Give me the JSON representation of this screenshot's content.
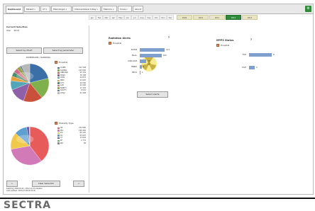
{
  "tabs": [
    {
      "label": "Dashboard"
    },
    {
      "label": "Patient"
    },
    {
      "label": "CT"
    },
    {
      "label": "Plain/Angio"
    },
    {
      "label": "Interventional X-Ray"
    },
    {
      "label": "Mammo"
    },
    {
      "label": "Cross"
    },
    {
      "label": "About"
    }
  ],
  "months": [
    "Jan",
    "Feb",
    "Mar",
    "Apr",
    "May",
    "Jun",
    "Jul",
    "Aug",
    "Sep",
    "Oct",
    "Nov",
    "Dec"
  ],
  "years": [
    {
      "label": "2009",
      "selected": false
    },
    {
      "label": "2010",
      "selected": false
    },
    {
      "label": "2011",
      "selected": false
    },
    {
      "label": "2012",
      "selected": true
    },
    {
      "label": "2013",
      "selected": false
    }
  ],
  "left": {
    "current_selection": "Current Selection",
    "year_label": "Year",
    "year_value": "2012",
    "select_chart_btn": "Select by Chart",
    "select_param_btn": "Select by parameter",
    "dimension_title": "DIMENSION / RANKING",
    "hospital_label": "Hospital",
    "hospital_rows": [
      {
        "label": "CLINIC",
        "value": "121 548",
        "color": "#3b6fa8"
      },
      {
        "label": "GLOBAL",
        "value": "103 000",
        "color": "#7fb04b"
      },
      {
        "label": "UNILUND",
        "value": "93 154",
        "color": "#c9503a"
      },
      {
        "label": "HOSP",
        "value": "78 108",
        "color": "#8f5fa8"
      },
      {
        "label": "ICON",
        "value": "44 872",
        "color": "#52a6b8"
      },
      {
        "label": "MED",
        "value": "23 087",
        "color": "#e8a03c"
      },
      {
        "label": "CITY",
        "value": "22 000",
        "color": "#4a8f6d"
      },
      {
        "label": "LAB",
        "value": "21 000",
        "color": "#d06b8a"
      },
      {
        "label": "NORTH",
        "value": "17 432",
        "color": "#9aa14a"
      },
      {
        "label": "SOUTH",
        "value": "8 001",
        "color": "#5d7f9f"
      },
      {
        "label": "Other",
        "value": "41 948",
        "color": "#b8b8b8"
      }
    ],
    "modality_label": "Modality Type",
    "modality_rows": [
      {
        "label": "CR",
        "value": "232 660",
        "color": "#e85b5b"
      },
      {
        "label": "MG",
        "value": "190 462",
        "color": "#d27ab8"
      },
      {
        "label": "DX",
        "value": "84 125",
        "color": "#f1c94a"
      },
      {
        "label": "XA",
        "value": "63 097",
        "color": "#5f9fcf"
      },
      {
        "label": "CT",
        "value": "13 093",
        "color": "#6a5fae"
      },
      {
        "label": "RF",
        "value": "2 731",
        "color": "#5fae7b"
      },
      {
        "label": "MR",
        "value": "56",
        "color": "#888888"
      }
    ],
    "clear_btn": "Clear Selection",
    "prev_btn": "<",
    "next_btn": ">",
    "footer_line1": "Selecting 2009-01-01 / 2012-12-31 situation",
    "footer_line2": "Last updated: 2013-07-08 09:31:00"
  },
  "radiation": {
    "title": "Radiation Alerts",
    "help": "?",
    "hospital_label": "Hospital",
    "select_btn": "Select Alerts",
    "rows": [
      {
        "label": "NUSM",
        "value": "117",
        "fraction": 0.7
      },
      {
        "label": "BLAL",
        "value": "102",
        "fraction": 0.61
      },
      {
        "label": "UNILASM",
        "value": "30",
        "fraction": 0.18
      },
      {
        "label": "HNBO",
        "value": "6",
        "fraction": 0.05
      },
      {
        "label": "HELS",
        "value": "1",
        "fraction": 0.01
      }
    ]
  },
  "mpps": {
    "title": "MPPS Status",
    "help": "?",
    "hospital_label": "Hospital",
    "rows": [
      {
        "label": "TSH",
        "value": "8",
        "fraction": 0.8
      },
      {
        "label": "CGH",
        "value": "2",
        "fraction": 0.2
      }
    ]
  },
  "brand": "SECTRA",
  "colors": {
    "accent": "#2e8b3a",
    "bar": "#7f9fcf",
    "radiation": "#f1d84a"
  }
}
